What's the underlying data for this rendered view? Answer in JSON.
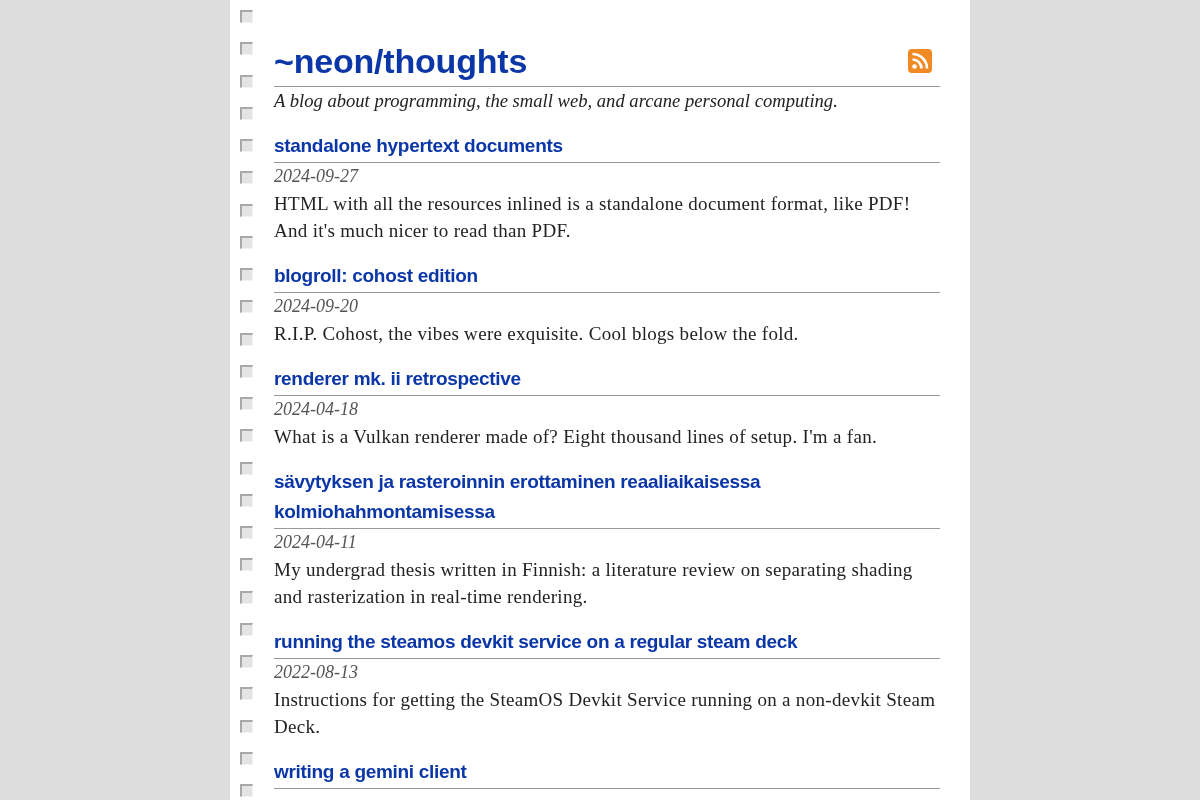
{
  "blog": {
    "title": "~neon/thoughts",
    "tagline": "A blog about programming, the small web, and arcane personal computing."
  },
  "posts": [
    {
      "title": "standalone hypertext documents",
      "date": "2024-09-27",
      "summary": "HTML with all the resources inlined is a standalone document format, like PDF! And it's much nicer to read than PDF."
    },
    {
      "title": "blogroll: cohost edition",
      "date": "2024-09-20",
      "summary": "R.I.P. Cohost, the vibes were exquisite. Cool blogs below the fold."
    },
    {
      "title": "renderer mk. ii retrospective",
      "date": "2024-04-18",
      "summary": "What is a Vulkan renderer made of? Eight thousand lines of setup. I'm a fan."
    },
    {
      "title": "sävytyksen ja rasteroinnin erottaminen reaaliaikaisessa kolmiohahmontamisessa",
      "date": "2024-04-11",
      "summary": "My undergrad thesis written in Finnish: a literature review on separating shading and rasterization in real-time rendering."
    },
    {
      "title": "running the steamos devkit service on a regular steam deck",
      "date": "2022-08-13",
      "summary": "Instructions for getting the SteamOS Devkit Service running on a non-devkit Steam Deck."
    },
    {
      "title": "writing a gemini client"
    }
  ]
}
